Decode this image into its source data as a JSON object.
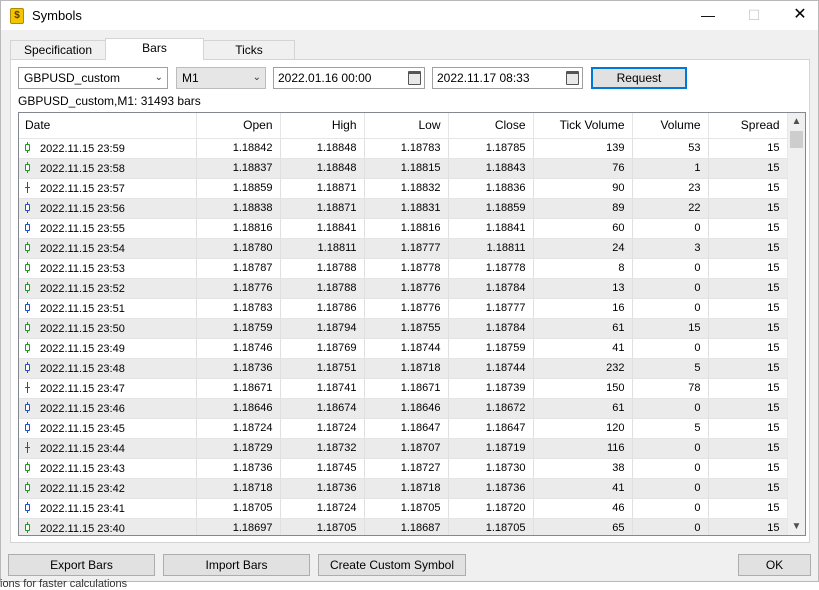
{
  "window": {
    "title": "Symbols"
  },
  "tabs": [
    {
      "label": "Specification"
    },
    {
      "label": "Bars"
    },
    {
      "label": "Ticks"
    }
  ],
  "controls": {
    "symbol": "GBPUSD_custom",
    "timeframe": "M1",
    "date_from": "2022.01.16 00:00",
    "date_to": "2022.11.17 08:33",
    "request_label": "Request"
  },
  "info_text": "GBPUSD_custom,M1: 31493 bars",
  "table": {
    "columns": [
      "Date",
      "Open",
      "High",
      "Low",
      "Close",
      "Tick Volume",
      "Volume",
      "Spread"
    ],
    "rows": [
      {
        "date": "2022.11.15 23:59",
        "open": "1.18842",
        "high": "1.18848",
        "low": "1.18783",
        "close": "1.18785",
        "tick_volume": "139",
        "volume": "53",
        "spread": "15",
        "candle": "bull"
      },
      {
        "date": "2022.11.15 23:58",
        "open": "1.18837",
        "high": "1.18848",
        "low": "1.18815",
        "close": "1.18843",
        "tick_volume": "76",
        "volume": "1",
        "spread": "15",
        "candle": "bull"
      },
      {
        "date": "2022.11.15 23:57",
        "open": "1.18859",
        "high": "1.18871",
        "low": "1.18832",
        "close": "1.18836",
        "tick_volume": "90",
        "volume": "23",
        "spread": "15",
        "candle": "doji"
      },
      {
        "date": "2022.11.15 23:56",
        "open": "1.18838",
        "high": "1.18871",
        "low": "1.18831",
        "close": "1.18859",
        "tick_volume": "89",
        "volume": "22",
        "spread": "15",
        "candle": "bear"
      },
      {
        "date": "2022.11.15 23:55",
        "open": "1.18816",
        "high": "1.18841",
        "low": "1.18816",
        "close": "1.18841",
        "tick_volume": "60",
        "volume": "0",
        "spread": "15",
        "candle": "bear"
      },
      {
        "date": "2022.11.15 23:54",
        "open": "1.18780",
        "high": "1.18811",
        "low": "1.18777",
        "close": "1.18811",
        "tick_volume": "24",
        "volume": "3",
        "spread": "15",
        "candle": "bull"
      },
      {
        "date": "2022.11.15 23:53",
        "open": "1.18787",
        "high": "1.18788",
        "low": "1.18778",
        "close": "1.18778",
        "tick_volume": "8",
        "volume": "0",
        "spread": "15",
        "candle": "bull"
      },
      {
        "date": "2022.11.15 23:52",
        "open": "1.18776",
        "high": "1.18788",
        "low": "1.18776",
        "close": "1.18784",
        "tick_volume": "13",
        "volume": "0",
        "spread": "15",
        "candle": "bull"
      },
      {
        "date": "2022.11.15 23:51",
        "open": "1.18783",
        "high": "1.18786",
        "low": "1.18776",
        "close": "1.18777",
        "tick_volume": "16",
        "volume": "0",
        "spread": "15",
        "candle": "bear"
      },
      {
        "date": "2022.11.15 23:50",
        "open": "1.18759",
        "high": "1.18794",
        "low": "1.18755",
        "close": "1.18784",
        "tick_volume": "61",
        "volume": "15",
        "spread": "15",
        "candle": "bull"
      },
      {
        "date": "2022.11.15 23:49",
        "open": "1.18746",
        "high": "1.18769",
        "low": "1.18744",
        "close": "1.18759",
        "tick_volume": "41",
        "volume": "0",
        "spread": "15",
        "candle": "bull"
      },
      {
        "date": "2022.11.15 23:48",
        "open": "1.18736",
        "high": "1.18751",
        "low": "1.18718",
        "close": "1.18744",
        "tick_volume": "232",
        "volume": "5",
        "spread": "15",
        "candle": "bear"
      },
      {
        "date": "2022.11.15 23:47",
        "open": "1.18671",
        "high": "1.18741",
        "low": "1.18671",
        "close": "1.18739",
        "tick_volume": "150",
        "volume": "78",
        "spread": "15",
        "candle": "doji"
      },
      {
        "date": "2022.11.15 23:46",
        "open": "1.18646",
        "high": "1.18674",
        "low": "1.18646",
        "close": "1.18672",
        "tick_volume": "61",
        "volume": "0",
        "spread": "15",
        "candle": "bear"
      },
      {
        "date": "2022.11.15 23:45",
        "open": "1.18724",
        "high": "1.18724",
        "low": "1.18647",
        "close": "1.18647",
        "tick_volume": "120",
        "volume": "5",
        "spread": "15",
        "candle": "bear"
      },
      {
        "date": "2022.11.15 23:44",
        "open": "1.18729",
        "high": "1.18732",
        "low": "1.18707",
        "close": "1.18719",
        "tick_volume": "116",
        "volume": "0",
        "spread": "15",
        "candle": "doji"
      },
      {
        "date": "2022.11.15 23:43",
        "open": "1.18736",
        "high": "1.18745",
        "low": "1.18727",
        "close": "1.18730",
        "tick_volume": "38",
        "volume": "0",
        "spread": "15",
        "candle": "bull"
      },
      {
        "date": "2022.11.15 23:42",
        "open": "1.18718",
        "high": "1.18736",
        "low": "1.18718",
        "close": "1.18736",
        "tick_volume": "41",
        "volume": "0",
        "spread": "15",
        "candle": "bull"
      },
      {
        "date": "2022.11.15 23:41",
        "open": "1.18705",
        "high": "1.18724",
        "low": "1.18705",
        "close": "1.18720",
        "tick_volume": "46",
        "volume": "0",
        "spread": "15",
        "candle": "bear"
      },
      {
        "date": "2022.11.15 23:40",
        "open": "1.18697",
        "high": "1.18705",
        "low": "1.18687",
        "close": "1.18705",
        "tick_volume": "65",
        "volume": "0",
        "spread": "15",
        "candle": "bull"
      }
    ]
  },
  "buttons": {
    "export": "Export Bars",
    "import": "Import Bars",
    "create": "Create Custom Symbol",
    "ok": "OK"
  },
  "footer_text": "ions for faster calculations"
}
